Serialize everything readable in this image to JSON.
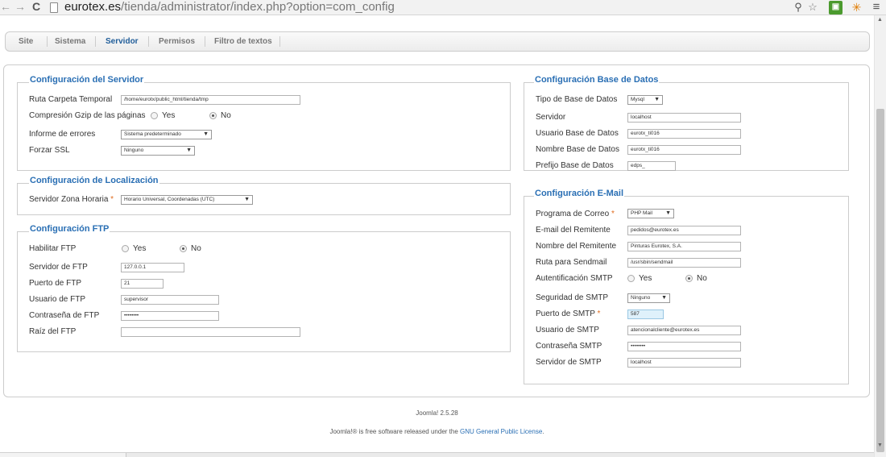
{
  "browser": {
    "url_host": "eurotex.es",
    "url_path": "/tienda/administrator/index.php?option=com_config"
  },
  "tabs": [
    "Site",
    "Sistema",
    "Servidor",
    "Permisos",
    "Filtro de textos"
  ],
  "active_tab": "Servidor",
  "server": {
    "legend": "Configuración del Servidor",
    "tmp_label": "Ruta Carpeta Temporal",
    "tmp_value": "/home/eurotx/public_html/tienda/tmp",
    "gzip_label": "Compresión Gzip de las páginas",
    "gzip_yes": "Yes",
    "gzip_no": "No",
    "gzip_selected": "No",
    "errors_label": "Informe de errores",
    "errors_value": "Sistema predeterminado",
    "ssl_label": "Forzar SSL",
    "ssl_value": "Ninguno"
  },
  "locale": {
    "legend": "Configuración de Localización",
    "tz_label": "Servidor Zona Horaria",
    "tz_required": "*",
    "tz_value": "Horario Universal, Coordenadas (UTC)"
  },
  "ftp": {
    "legend": "Configuración FTP",
    "enable_label": "Habilitar FTP",
    "enable_yes": "Yes",
    "enable_no": "No",
    "enable_selected": "No",
    "host_label": "Servidor de FTP",
    "host_value": "127.0.0.1",
    "port_label": "Puerto de FTP",
    "port_value": "21",
    "user_label": "Usuario de FTP",
    "user_value": "supervisor",
    "pass_label": "Contraseña de FTP",
    "pass_value": "••••••••",
    "root_label": "Raíz del FTP",
    "root_value": ""
  },
  "database": {
    "legend": "Configuración Base de Datos",
    "type_label": "Tipo de Base de Datos",
    "type_value": "Mysql",
    "host_label": "Servidor",
    "host_value": "localhost",
    "user_label": "Usuario Base de Datos",
    "user_value": "eurotx_ti016",
    "name_label": "Nombre Base de Datos",
    "name_value": "eurotx_ti016",
    "prefix_label": "Prefijo Base de Datos",
    "prefix_value": "edps_"
  },
  "email": {
    "legend": "Configuración E-Mail",
    "mailer_label": "Programa de Correo",
    "mailer_required": "*",
    "mailer_value": "PHP Mail",
    "from_label": "E-mail del Remitente",
    "from_value": "pedidos@eurotex.es",
    "fromname_label": "Nombre del Remitente",
    "fromname_value": "Pinturas Eurotex, S.A.",
    "sendmail_label": "Ruta para Sendmail",
    "sendmail_value": "/usr/sbin/sendmail",
    "smtpauth_label": "Autentificación SMTP",
    "smtpauth_yes": "Yes",
    "smtpauth_no": "No",
    "smtpauth_selected": "No",
    "smtpsecure_label": "Seguridad de SMTP",
    "smtpsecure_value": "Ninguno",
    "smtpport_label": "Puerto de SMTP",
    "smtpport_required": "*",
    "smtpport_value": "587",
    "smtpuser_label": "Usuario de SMTP",
    "smtpuser_value": "atencionalcliente@eurotex.es",
    "smtppass_label": "Contraseña SMTP",
    "smtppass_value": "••••••••",
    "smtphost_label": "Servidor de SMTP",
    "smtphost_value": "localhost"
  },
  "footer": {
    "version": "Joomla! 2.5.28",
    "license_prefix": "Joomla!® is free software released under the ",
    "license_link": "GNU General Public License",
    "license_suffix": "."
  }
}
